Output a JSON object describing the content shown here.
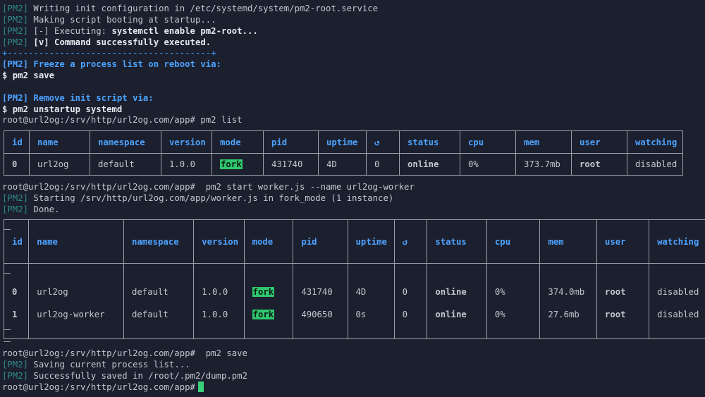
{
  "lines": {
    "l1_tag": "[PM2]",
    "l1_text": " Writing init configuration in /etc/systemd/system/pm2-root.service",
    "l2_tag": "[PM2]",
    "l2_text": " Making script booting at startup...",
    "l3_tag": "[PM2]",
    "l3_text": " [-] Executing: ",
    "l3_cmd": "systemctl enable pm2-root...",
    "l4_tag": "[PM2]",
    "l4_text": " [v] Command successfully executed.",
    "l5_sep": "+---------------------------------------+",
    "l6_text": "[PM2] Freeze a process list on reboot via:",
    "l7_text": "$ pm2 save",
    "l8_text": "[PM2] Remove init script via:",
    "l9_text": "$ pm2 unstartup systemd",
    "l10_text": "root@url2og:/srv/http/url2og.com/app# pm2 list",
    "l11_text": "root@url2og:/srv/http/url2og.com/app#  pm2 start worker.js --name url2og-worker",
    "l12_tag": "[PM2]",
    "l12_text": " Starting /srv/http/url2og.com/app/worker.js in fork_mode (1 instance)",
    "l13_tag": "[PM2]",
    "l13_text": " Done.",
    "l14_text": "root@url2og:/srv/http/url2og.com/app#  pm2 save",
    "l15_tag": "[PM2]",
    "l15_text": " Saving current process list...",
    "l16_tag": "[PM2]",
    "l16_text": " Successfully saved in /root/.pm2/dump.pm2",
    "l17_text": "root@url2og:/srv/http/url2og.com/app#"
  },
  "table1": {
    "headers": [
      "id",
      "name",
      "namespace",
      "version",
      "mode",
      "pid",
      "uptime",
      "↺",
      "status",
      "cpu",
      "mem",
      "user",
      "watching"
    ],
    "rows": [
      [
        "0",
        "url2og",
        "default",
        "1.0.0",
        "fork",
        "431740",
        "4D",
        "0",
        "online",
        "0%",
        "373.7mb",
        "root",
        "disabled"
      ]
    ]
  },
  "table2": {
    "headers": [
      "id",
      "name",
      "namespace",
      "version",
      "mode",
      "pid",
      "uptime",
      "↺",
      "status",
      "cpu",
      "mem",
      "user",
      "watching"
    ],
    "rows": [
      [
        "0",
        "url2og",
        "default",
        "1.0.0",
        "fork",
        "431740",
        "4D",
        "0",
        "online",
        "0%",
        "374.0mb",
        "root",
        "disabled"
      ],
      [
        "1",
        "url2og-worker",
        "default",
        "1.0.0",
        "fork",
        "490650",
        "0s",
        "0",
        "online",
        "0%",
        "27.6mb",
        "root",
        "disabled"
      ]
    ]
  },
  "colors": {
    "background": "#1b1f2e",
    "tag": "#2f8a88",
    "header": "#4da3ff",
    "online": "#39d07a",
    "badge": "#2ec86e"
  }
}
